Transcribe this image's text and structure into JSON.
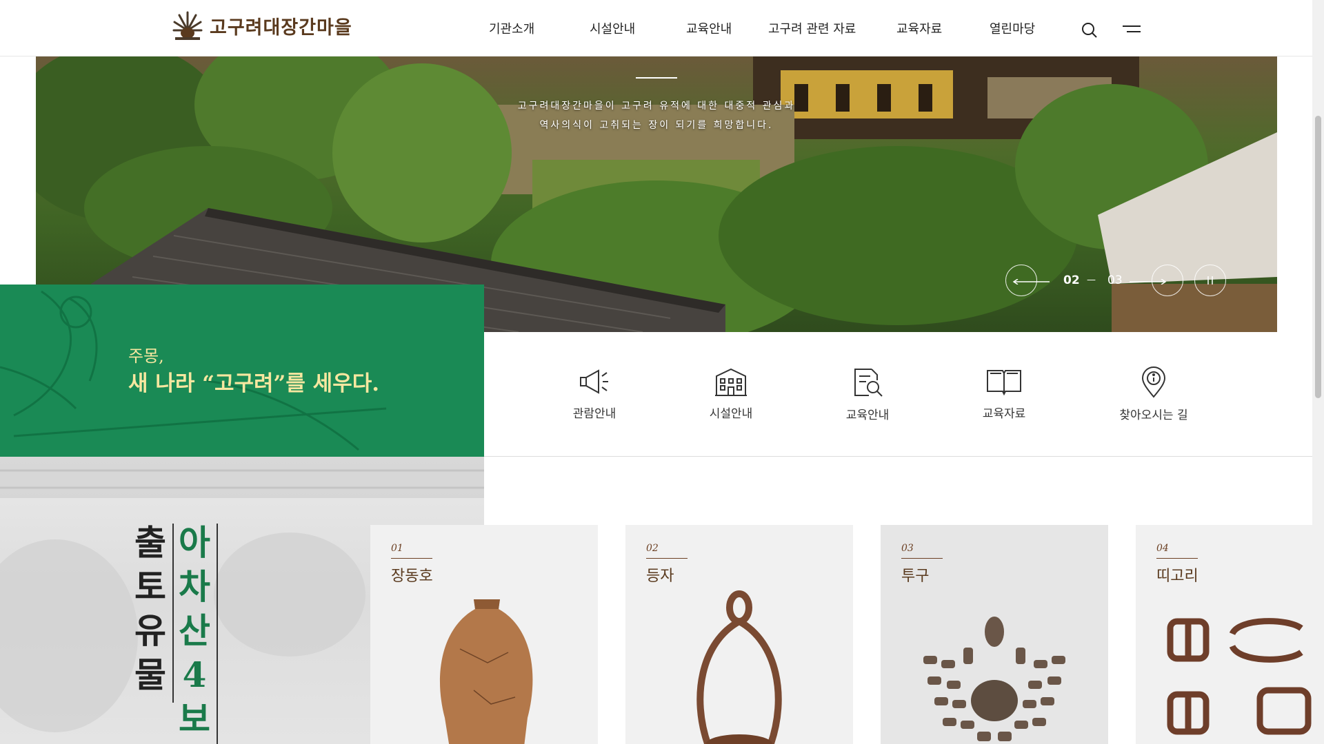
{
  "header": {
    "logo_text": "고구려대장간마을",
    "nav": [
      "기관소개",
      "시설안내",
      "교육안내",
      "고구려 관련 자료",
      "교육자료",
      "열린마당"
    ]
  },
  "hero": {
    "caption_line1": "고구려대장간마을이 고구려 유적에 대한 대중적 관심과",
    "caption_line2": "역사의식이 고취되는 장이 되기를 희망합니다.",
    "current_slide": "02",
    "total_slide": "03",
    "separator": "—"
  },
  "banner": {
    "subtitle": "주몽,",
    "title": "새 나라 “고구려”를 세우다."
  },
  "quick_links": [
    {
      "label": "관람안내",
      "icon": "megaphone-icon"
    },
    {
      "label": "시설안내",
      "icon": "building-icon"
    },
    {
      "label": "교육안내",
      "icon": "document-search-icon"
    },
    {
      "label": "교육자료",
      "icon": "book-icon"
    },
    {
      "label": "찾아오시는 길",
      "icon": "location-icon"
    }
  ],
  "artifacts_section": {
    "title_col1": [
      "출",
      "토",
      "유",
      "물"
    ],
    "title_col2": [
      "아",
      "차",
      "산",
      "4",
      "보"
    ],
    "title_col2_color": "#1a7a4a"
  },
  "artifacts": [
    {
      "num": "01",
      "name": "장동호"
    },
    {
      "num": "02",
      "name": "등자"
    },
    {
      "num": "03",
      "name": "투구"
    },
    {
      "num": "04",
      "name": "띠고리"
    }
  ]
}
